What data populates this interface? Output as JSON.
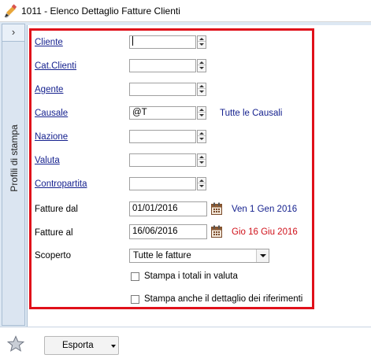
{
  "window": {
    "title": "1011 - Elenco Dettaglio Fatture Clienti"
  },
  "side_panel": {
    "expand_glyph": "›",
    "label": "Profili di stampa"
  },
  "form": {
    "cliente": {
      "label": "Cliente",
      "value": ""
    },
    "cat_clienti": {
      "label": "Cat.Clienti",
      "value": ""
    },
    "agente": {
      "label": "Agente",
      "value": ""
    },
    "causale": {
      "label": "Causale",
      "value": "@T",
      "description": "Tutte le Causali"
    },
    "nazione": {
      "label": "Nazione",
      "value": ""
    },
    "valuta": {
      "label": "Valuta",
      "value": ""
    },
    "contropartita": {
      "label": "Contropartita",
      "value": ""
    },
    "fatture_dal": {
      "label": "Fatture dal",
      "value": "01/01/2016",
      "description": "Ven 1 Gen 2016",
      "description_color": "#16228f"
    },
    "fatture_al": {
      "label": "Fatture al",
      "value": "16/06/2016",
      "description": "Gio 16 Giu 2016",
      "description_color": "#d0121b"
    },
    "scoperto": {
      "label": "Scoperto",
      "selected": "Tutte le fatture"
    },
    "stampa_totali_valuta": {
      "label": "Stampa i totali in valuta",
      "checked": false
    },
    "stampa_dettaglio_riferimenti": {
      "label": "Stampa anche il dettaglio dei riferimenti",
      "checked": false
    }
  },
  "footer": {
    "export_label": "Esporta",
    "star_icon": "star-icon"
  },
  "colors": {
    "highlight_border": "#e0101a",
    "link": "#16228f",
    "panel_bg": "#dde8f3"
  }
}
